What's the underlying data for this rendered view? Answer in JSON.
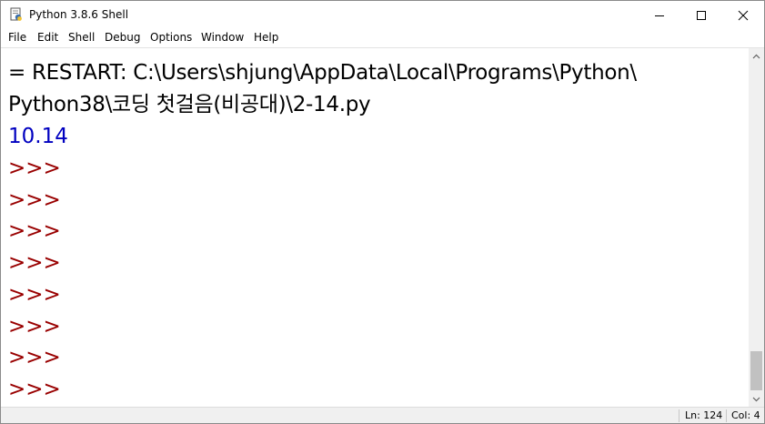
{
  "window": {
    "title": "Python 3.8.6 Shell",
    "icon": "idle-python-icon",
    "controls": {
      "minimize": "minimize-icon",
      "maximize": "maximize-icon",
      "close": "close-icon"
    }
  },
  "menu": {
    "items": [
      "File",
      "Edit",
      "Shell",
      "Debug",
      "Options",
      "Window",
      "Help"
    ]
  },
  "shell": {
    "restart_line": "= RESTART: C:\\Users\\shjung\\AppData\\Local\\Programs\\Python\\",
    "path_line": "Python38\\코딩 첫걸음(비공대)\\2-14.py",
    "output": "10.14",
    "prompt": ">>>",
    "prompt_count": 8
  },
  "status": {
    "line": "Ln: 124",
    "col": "Col: 4"
  },
  "colors": {
    "output": "#0000c0",
    "prompt": "#990000",
    "text": "#000000"
  }
}
